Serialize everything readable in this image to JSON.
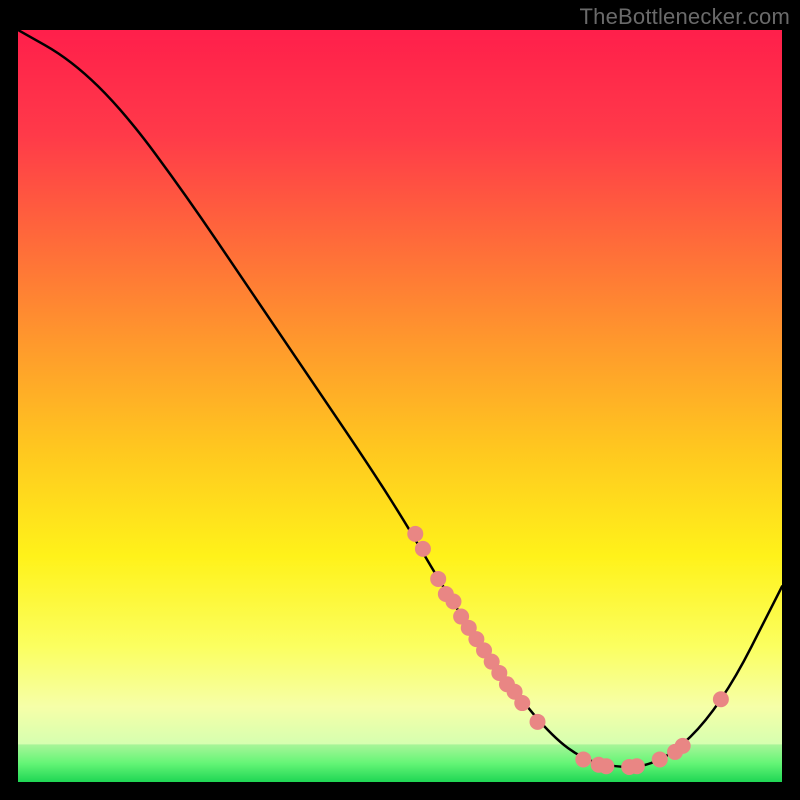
{
  "watermark": "TheBottlenecker.com",
  "chart_data": {
    "type": "line",
    "title": "",
    "xlabel": "",
    "ylabel": "",
    "xlim": [
      0,
      100
    ],
    "ylim": [
      0,
      100
    ],
    "green_band": {
      "y_min": 0,
      "y_max": 5
    },
    "curve": [
      {
        "x": 0,
        "y": 100
      },
      {
        "x": 7,
        "y": 96
      },
      {
        "x": 14,
        "y": 89
      },
      {
        "x": 22,
        "y": 78
      },
      {
        "x": 30,
        "y": 66
      },
      {
        "x": 38,
        "y": 54
      },
      {
        "x": 46,
        "y": 42
      },
      {
        "x": 51,
        "y": 34
      },
      {
        "x": 55,
        "y": 27
      },
      {
        "x": 60,
        "y": 19
      },
      {
        "x": 65,
        "y": 12
      },
      {
        "x": 70,
        "y": 6
      },
      {
        "x": 74,
        "y": 3
      },
      {
        "x": 78,
        "y": 2
      },
      {
        "x": 82,
        "y": 2
      },
      {
        "x": 86,
        "y": 4
      },
      {
        "x": 90,
        "y": 8
      },
      {
        "x": 94,
        "y": 14
      },
      {
        "x": 98,
        "y": 22
      },
      {
        "x": 100,
        "y": 26
      }
    ],
    "markers": [
      {
        "x": 52,
        "y": 33
      },
      {
        "x": 53,
        "y": 31
      },
      {
        "x": 55,
        "y": 27
      },
      {
        "x": 56,
        "y": 25
      },
      {
        "x": 57,
        "y": 24
      },
      {
        "x": 58,
        "y": 22
      },
      {
        "x": 59,
        "y": 20.5
      },
      {
        "x": 60,
        "y": 19
      },
      {
        "x": 61,
        "y": 17.5
      },
      {
        "x": 62,
        "y": 16
      },
      {
        "x": 63,
        "y": 14.5
      },
      {
        "x": 64,
        "y": 13
      },
      {
        "x": 65,
        "y": 12
      },
      {
        "x": 66,
        "y": 10.5
      },
      {
        "x": 68,
        "y": 8
      },
      {
        "x": 74,
        "y": 3
      },
      {
        "x": 76,
        "y": 2.3
      },
      {
        "x": 77,
        "y": 2.1
      },
      {
        "x": 80,
        "y": 2
      },
      {
        "x": 81,
        "y": 2.1
      },
      {
        "x": 84,
        "y": 3
      },
      {
        "x": 86,
        "y": 4
      },
      {
        "x": 87,
        "y": 4.8
      },
      {
        "x": 92,
        "y": 11
      }
    ],
    "gradient_stops": [
      {
        "offset": 0.0,
        "color": "#ff1f4b"
      },
      {
        "offset": 0.14,
        "color": "#ff3a49"
      },
      {
        "offset": 0.28,
        "color": "#ff6a3a"
      },
      {
        "offset": 0.42,
        "color": "#ff9a2c"
      },
      {
        "offset": 0.56,
        "color": "#ffc81f"
      },
      {
        "offset": 0.7,
        "color": "#fff21a"
      },
      {
        "offset": 0.82,
        "color": "#fbff60"
      },
      {
        "offset": 0.9,
        "color": "#f6ffa8"
      },
      {
        "offset": 0.95,
        "color": "#d6ffb0"
      },
      {
        "offset": 0.975,
        "color": "#7cff82"
      },
      {
        "offset": 1.0,
        "color": "#1fd655"
      }
    ],
    "colors": {
      "curve": "#000000",
      "marker_fill": "#e98684",
      "marker_stroke": "#c46a68",
      "frame": "#000000",
      "background": "#000000"
    }
  }
}
